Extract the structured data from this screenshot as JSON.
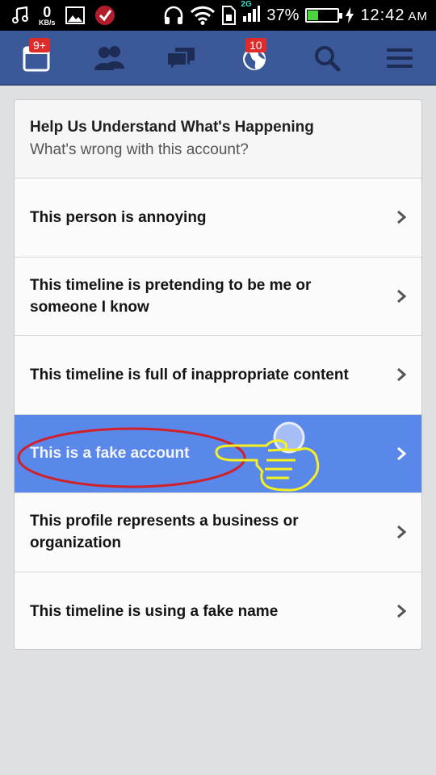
{
  "status_bar": {
    "speed_value": "0",
    "speed_unit": "KB/s",
    "network_type": "2G",
    "battery_percent": "37%",
    "battery_level": 0.37,
    "time": "12:42",
    "ampm": "AM"
  },
  "nav": {
    "notifications_badge": "9+",
    "globe_badge": "10",
    "color": "#3b5998"
  },
  "report": {
    "title": "Help Us Understand What's Happening",
    "subtitle": "What's wrong with this account?",
    "options": [
      {
        "label": "This person is annoying"
      },
      {
        "label": "This timeline is pretending to be me or someone I know"
      },
      {
        "label": "This timeline is full of inappropriate content"
      },
      {
        "label": "This is a fake account",
        "selected": true
      },
      {
        "label": "This profile represents a business or organization"
      },
      {
        "label": "This timeline is using a fake name"
      }
    ],
    "selected_color": "#5a88ea"
  },
  "annotation": {
    "circle_color": "#d0202a",
    "pointer_color": "#f5f01e"
  }
}
